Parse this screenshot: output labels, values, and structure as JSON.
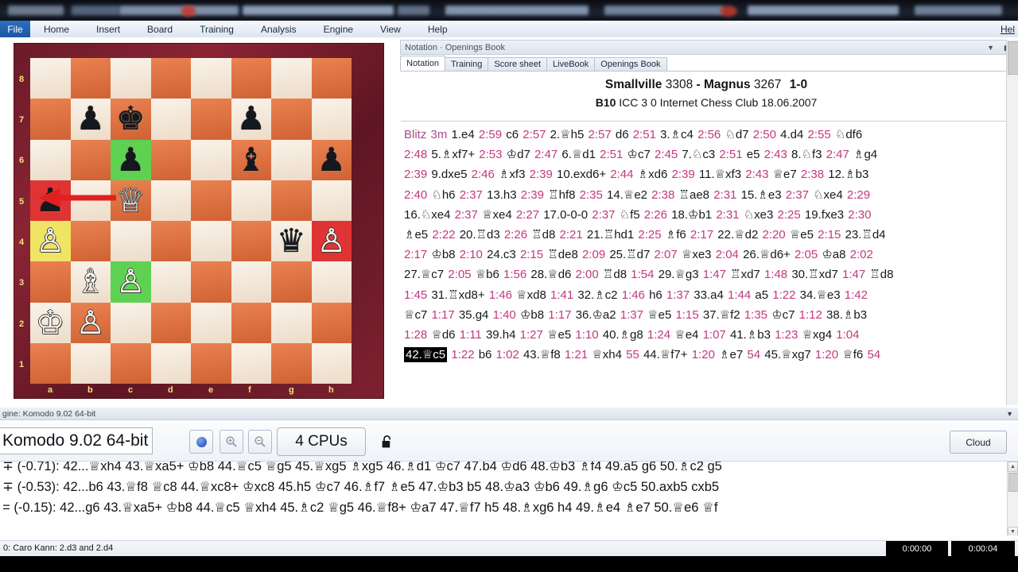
{
  "window": {
    "topbar_hint": "blurred background windows"
  },
  "menu": {
    "file_label": "File",
    "items": [
      "Home",
      "Insert",
      "Board",
      "Training",
      "Analysis",
      "Engine",
      "View"
    ],
    "help_label": "Help",
    "help_right_label": "Hel"
  },
  "board": {
    "files": [
      "a",
      "b",
      "c",
      "d",
      "e",
      "f",
      "g",
      "h"
    ],
    "ranks": [
      "8",
      "7",
      "6",
      "5",
      "4",
      "3",
      "2",
      "1"
    ],
    "rows": [
      [
        null,
        null,
        null,
        null,
        null,
        null,
        null,
        null
      ],
      [
        null,
        "bp",
        "bk",
        null,
        null,
        "bp",
        null,
        null
      ],
      [
        null,
        null,
        "bp",
        null,
        null,
        "bb",
        null,
        "bp"
      ],
      [
        "bp",
        null,
        "wq",
        null,
        null,
        null,
        null,
        null
      ],
      [
        "wp",
        null,
        null,
        null,
        null,
        null,
        "bq",
        "wp"
      ],
      [
        null,
        "wb",
        "wp",
        null,
        null,
        null,
        null,
        null
      ],
      [
        "wk",
        "wp",
        null,
        null,
        null,
        null,
        null,
        null
      ],
      [
        null,
        null,
        null,
        null,
        null,
        null,
        null,
        null
      ]
    ],
    "highlights": {
      "green": [
        "c6",
        "c3"
      ],
      "red": [
        "a5",
        "h4"
      ],
      "yellow": [
        "a4"
      ]
    },
    "arrow": {
      "from": "c5",
      "to": "a5",
      "color": "#e02020"
    }
  },
  "notation_panel": {
    "header_bar_title": "Notation · Openings Book",
    "tabs": [
      {
        "label": "Notation",
        "active": true
      },
      {
        "label": "Training",
        "active": false
      },
      {
        "label": "Score sheet",
        "active": false
      },
      {
        "label": "LiveBook",
        "active": false
      },
      {
        "label": "Openings Book",
        "active": false
      }
    ],
    "game_header": {
      "white_name": "Smallville",
      "white_elo": "3308",
      "dash": "-",
      "black_name": "Magnus",
      "black_elo": "3267",
      "result": "1-0",
      "eco": "B10",
      "event": "ICC 3 0 Internet Chess Club 18.06.2007"
    },
    "time_control_label": "Blitz 3m",
    "moves_lines": [
      "1.e4 2:59 c6 2:57 2.♕h5 2:57 d6 2:51 3.♗c4 2:56 ♘d7 2:50 4.d4 2:55 ♘df6",
      "2:48 5.♗xf7+ 2:53 ♔d7 2:47 6.♕d1 2:51 ♔c7 2:45 7.♘c3 2:51 e5 2:43 8.♘f3 2:47 ♗g4",
      "2:39 9.dxe5 2:46 ♗xf3 2:39 10.exd6+ 2:44 ♗xd6 2:39 11.♕xf3 2:43 ♕e7 2:38 12.♗b3",
      "2:40 ♘h6 2:37 13.h3 2:39 ♖hf8 2:35 14.♕e2 2:38 ♖ae8 2:31 15.♗e3 2:37 ♘xe4 2:29",
      "16.♘xe4 2:37 ♕xe4 2:27 17.0-0-0 2:37 ♘f5 2:26 18.♔b1 2:31 ♘xe3 2:25 19.fxe3 2:30",
      "♗e5 2:22 20.♖d3 2:26 ♖d8 2:21 21.♖hd1 2:25 ♗f6 2:17 22.♕d2 2:20 ♕e5 2:15 23.♖d4",
      "2:17 ♔b8 2:10 24.c3 2:15 ♖de8 2:09 25.♖d7 2:07 ♕xe3 2:04 26.♕d6+ 2:05 ♔a8 2:02",
      "27.♕c7 2:05 ♕b6 1:56 28.♕d6 2:00 ♖d8 1:54 29.♕g3 1:47 ♖xd7 1:48 30.♖xd7 1:47 ♖d8",
      "1:45 31.♖xd8+ 1:46 ♕xd8 1:41 32.♗c2 1:46 h6 1:37 33.a4 1:44 a5 1:22 34.♕e3 1:42",
      "♕c7 1:17 35.g4 1:40 ♔b8 1:17 36.♔a2 1:37 ♕e5 1:15 37.♕f2 1:35 ♔c7 1:12 38.♗b3",
      "1:28 ♕d6 1:11 39.h4 1:27 ♕e5 1:10 40.♗g8 1:24 ♕e4 1:07 41.♗b3 1:23 ♕xg4 1:04",
      "42.♕c5 1:22 b6 1:02 43.♕f8 1:21 ♕xh4 55 44.♕f7+ 1:20 ♗e7 54 45.♕xg7 1:20 ♕f6 54"
    ],
    "selected_move": "42.♕c5"
  },
  "engine_panel": {
    "title": "gine: Komodo 9.02 64-bit",
    "engine_name": "Komodo 9.02 64-bit",
    "cpu_label": "4 CPUs",
    "cloud_label": "Cloud",
    "buttons": [
      {
        "name": "engine-status-indicator",
        "glyph": "●"
      },
      {
        "name": "zoom-in-icon",
        "glyph": "+"
      },
      {
        "name": "zoom-out-icon",
        "glyph": "−"
      },
      {
        "name": "lock-icon",
        "glyph": "🔓"
      }
    ],
    "lines": [
      ". ∓ (-0.71): 42...♕xh4 43.♕xa5+ ♔b8 44.♕c5 ♕g5 45.♕xg5 ♗xg5 46.♗d1 ♔c7 47.b4 ♔d6 48.♔b3 ♗f4 49.a5 g6 50.♗c2 g5",
      ". ∓ (-0.53): 42...b6 43.♕f8 ♕c8 44.♕xc8+ ♔xc8 45.h5 ♔c7 46.♗f7 ♗e5 47.♔b3 b5 48.♔a3 ♔b6 49.♗g6 ♔c5 50.axb5 cxb5",
      ". = (-0.15): 42...g6 43.♕xa5+ ♔b8 44.♕c5 ♕xh4 45.♗c2 ♕g5 46.♕f8+ ♔a7 47.♕f7 h5 48.♗xg6 h4 49.♗e4 ♗e7 50.♕e6 ♕f"
    ]
  },
  "status_bar": {
    "eco_text": "0: Caro Kann: 2.d3 and 2.d4",
    "clock_white": "0:00:00",
    "clock_black": "0:00:04"
  },
  "colors": {
    "move_time": "#c2387f",
    "light_square": "#f2e3d0",
    "dark_square": "#d9693a",
    "highlight_green": "#5fd152",
    "highlight_red": "#e03434",
    "highlight_yellow": "#efe463",
    "board_frame": "#7d2130"
  }
}
